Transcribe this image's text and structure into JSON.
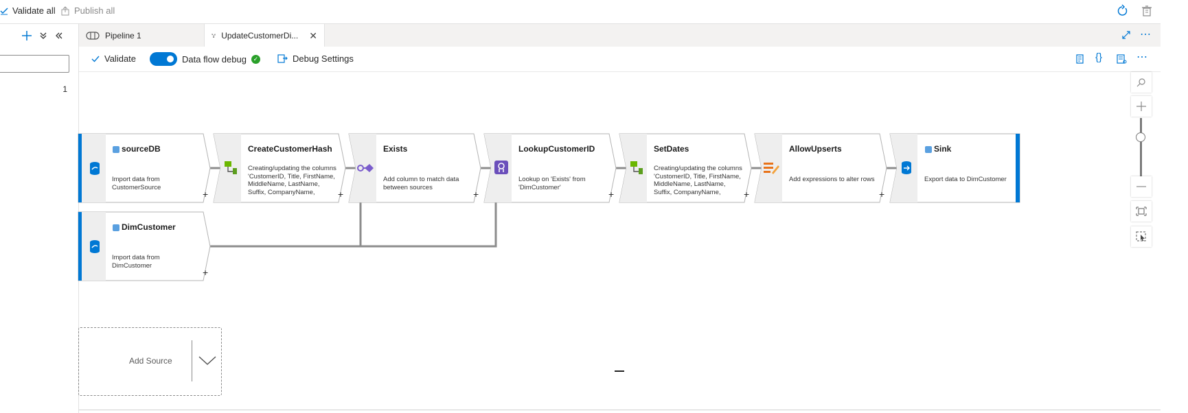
{
  "toolbar": {
    "validate_all": "Validate all",
    "publish_all": "Publish all"
  },
  "left_panel": {
    "count": "1"
  },
  "tabs": [
    {
      "label": "Pipeline 1",
      "icon": "pipeline-icon"
    },
    {
      "label": "UpdateCustomerDi...",
      "icon": "dataflow-icon",
      "active": true
    }
  ],
  "df_toolbar": {
    "validate": "Validate",
    "data_flow_debug": "Data flow debug",
    "debug_on": true,
    "debug_settings": "Debug Settings"
  },
  "nodes": [
    {
      "title": "sourceDB",
      "desc": "Import data from CustomerSource",
      "icon": "source-database-icon"
    },
    {
      "title": "CreateCustomerHash",
      "desc": "Creating/updating the columns 'CustomerID, Title, FirstName, MiddleName, LastName, Suffix, CompanyName, SalesPerson, EmailAddress, Phone'",
      "icon": "derived-column-icon"
    },
    {
      "title": "Exists",
      "desc": "Add column to match data between sources",
      "icon": "exists-icon"
    },
    {
      "title": "LookupCustomerID",
      "desc": "Lookup on 'Exists' from 'DimCustomer'",
      "icon": "lookup-icon"
    },
    {
      "title": "SetDates",
      "desc": "Creating/updating the columns 'CustomerID, Title, FirstName, MiddleName, LastName, Suffix, CompanyName, SalesPerson, EmailAddress'",
      "icon": "derived-column-icon"
    },
    {
      "title": "AllowUpserts",
      "desc": "Add expressions to alter rows",
      "icon": "alter-row-icon"
    },
    {
      "title": "Sink",
      "desc": "Export data to DimCustomer",
      "icon": "sink-database-icon"
    },
    {
      "title": "DimCustomer",
      "desc": "Import data from DimCustomer",
      "icon": "source-database-icon"
    }
  ],
  "add_source": "Add Source",
  "colors": {
    "accent": "#0078d4",
    "success": "#2aa02a",
    "node_border": "#b3b3b3",
    "icon_strip": "#eeeeee"
  }
}
